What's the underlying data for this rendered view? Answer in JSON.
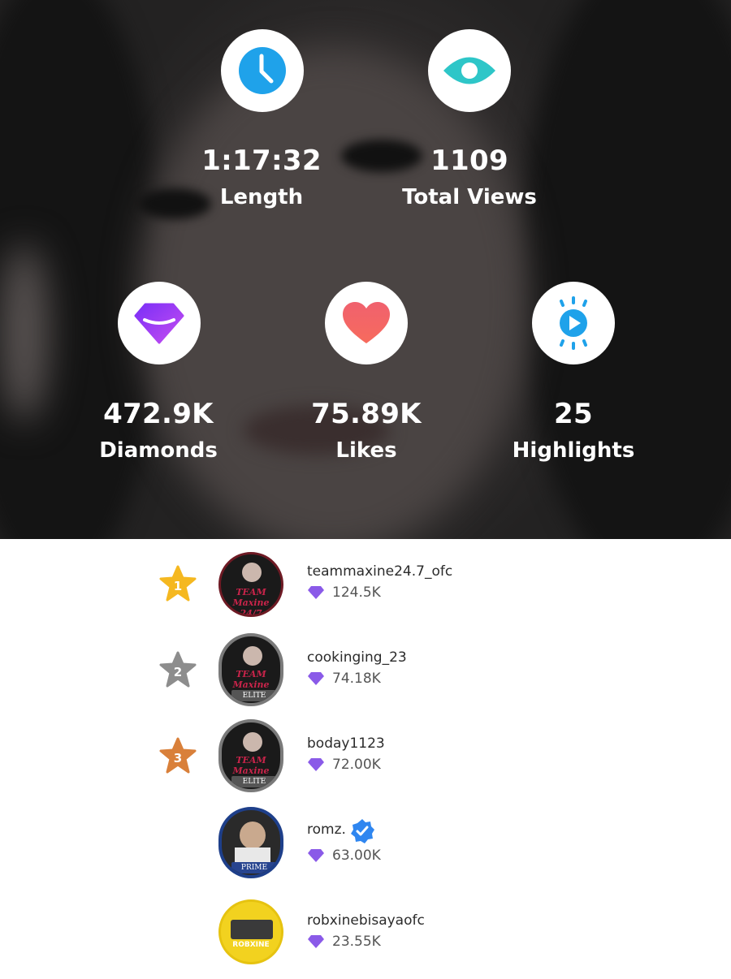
{
  "stats_top": [
    {
      "value": "1:17:32",
      "label": "Length",
      "icon": "clock-icon",
      "color": "#1fa2ea"
    },
    {
      "value": "1109",
      "label": "Total Views",
      "icon": "eye-icon",
      "color": "#2ec6c8"
    }
  ],
  "stats_bottom": [
    {
      "value": "472.9K",
      "label": "Diamonds",
      "icon": "diamond-icon",
      "color": "#9b3cf0"
    },
    {
      "value": "75.89K",
      "label": "Likes",
      "icon": "heart-icon",
      "color": "#f25a6a"
    },
    {
      "value": "25",
      "label": "Highlights",
      "icon": "highlights-play-icon",
      "color": "#1fa2ea"
    }
  ],
  "ranking": [
    {
      "rank": "1",
      "username": "teammaxine24.7_ofc",
      "diamonds": "124.5K",
      "avatar_text": "TEAM Maxine 24/7",
      "verified": false
    },
    {
      "rank": "2",
      "username": "cookinging_23",
      "diamonds": "74.18K",
      "avatar_text": "TEAM Maxine 24/7",
      "avatar_badge": "ELITE",
      "verified": false
    },
    {
      "rank": "3",
      "username": "boday1123",
      "diamonds": "72.00K",
      "avatar_text": "TEAM Maxine 24/7",
      "avatar_badge": "ELITE",
      "verified": false
    },
    {
      "rank": "",
      "username": "romz.",
      "diamonds": "63.00K",
      "avatar_badge": "PRIME",
      "verified": true
    },
    {
      "rank": "",
      "username": "robxinebisayaofc",
      "diamonds": "23.55K",
      "avatar_text": "ROBXINE",
      "verified": false
    }
  ],
  "colors": {
    "gold": "#f5b820",
    "silver": "#8d8d8d",
    "bronze": "#d9803a",
    "diamond": "#8a5ae8",
    "verified": "#2f86f0"
  }
}
